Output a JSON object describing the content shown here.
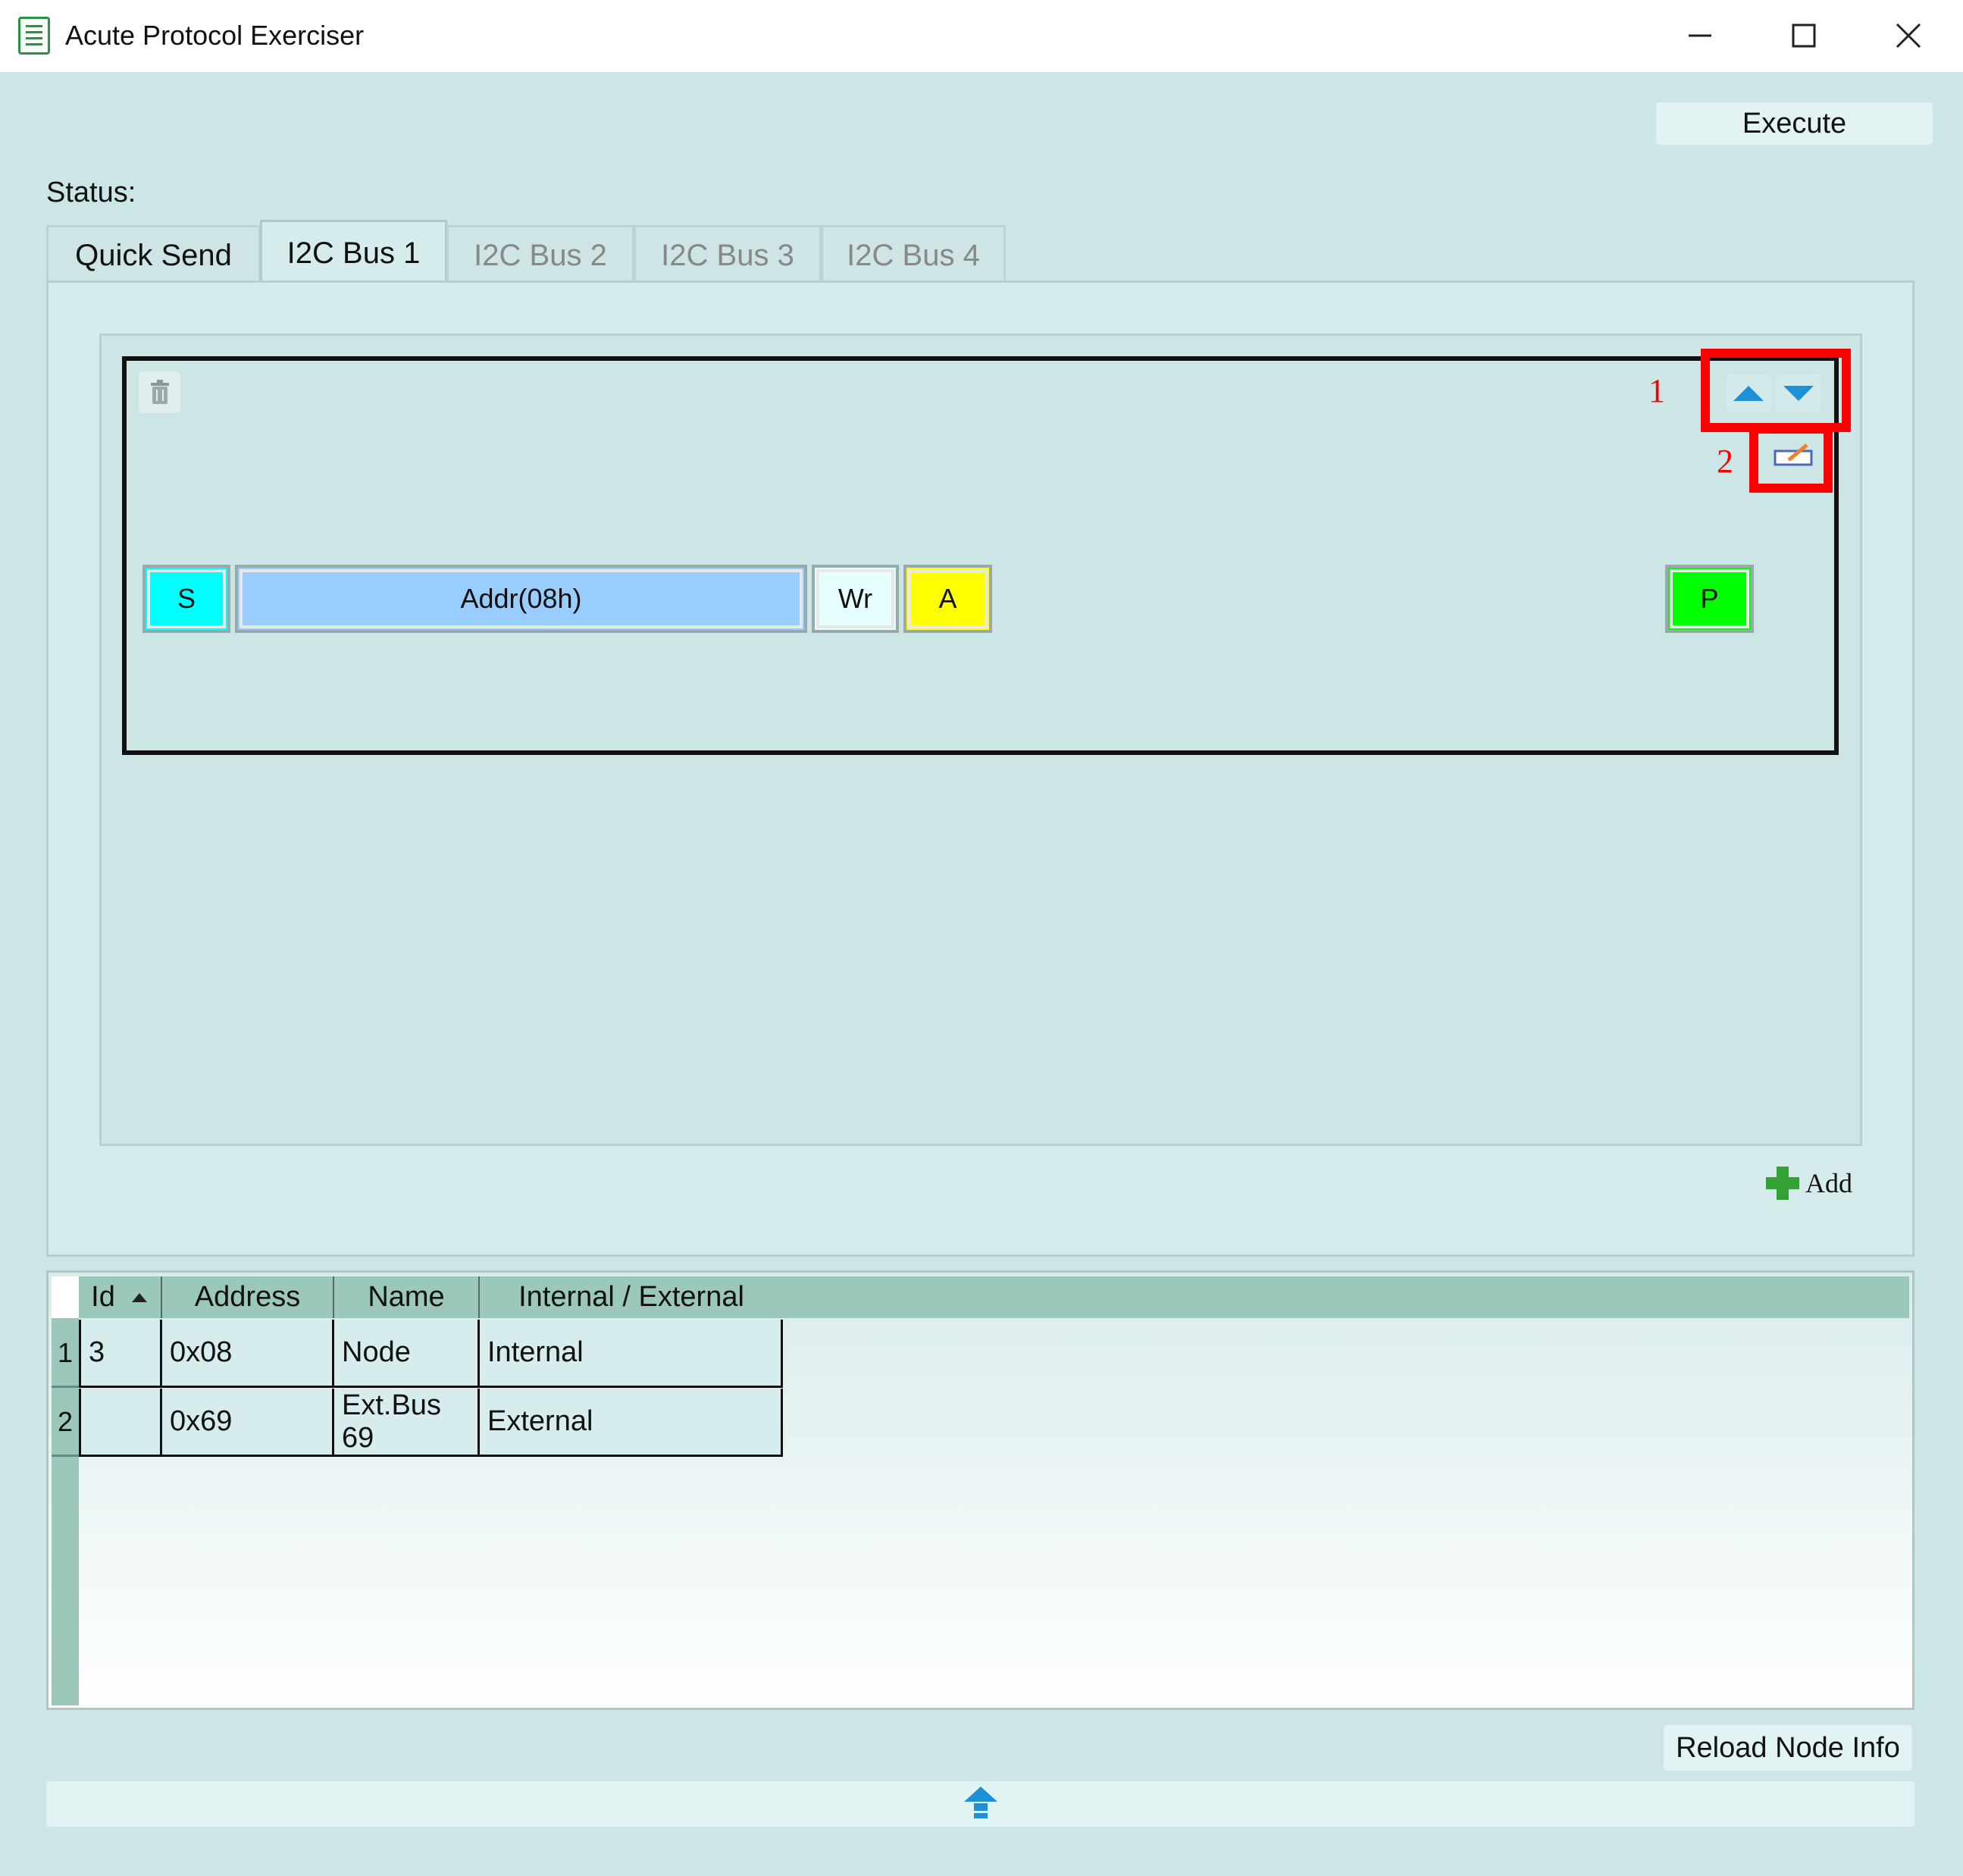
{
  "window": {
    "title": "Acute Protocol Exerciser",
    "controls": [
      "minimize",
      "maximize",
      "close"
    ]
  },
  "toolbar": {
    "execute_label": "Execute"
  },
  "status": {
    "label": "Status:"
  },
  "tabs": [
    {
      "label": "Quick Send",
      "active": false,
      "enabled": true
    },
    {
      "label": "I2C Bus 1",
      "active": true,
      "enabled": true
    },
    {
      "label": "I2C Bus 2",
      "active": false,
      "enabled": false
    },
    {
      "label": "I2C Bus 3",
      "active": false,
      "enabled": false
    },
    {
      "label": "I2C Bus 4",
      "active": false,
      "enabled": false
    }
  ],
  "sequence": {
    "segments": [
      {
        "label": "S",
        "color": "#00ffff"
      },
      {
        "label": "Addr(08h)",
        "color": "#99ccff"
      },
      {
        "label": "Wr",
        "color": "#e6ffff"
      },
      {
        "label": "A",
        "color": "#ffff00"
      },
      {
        "label": "P",
        "color": "#00ff00"
      }
    ],
    "annotations": {
      "move": "1",
      "edit": "2"
    },
    "icons": {
      "delete": "trash-icon",
      "up": "arrow-up-icon",
      "down": "arrow-down-icon",
      "edit": "edit-icon"
    }
  },
  "add": {
    "label": "Add",
    "icon": "plus-icon"
  },
  "node_table": {
    "columns": [
      "Id",
      "Address",
      "Name",
      "Internal / External"
    ],
    "sort_column": "Id",
    "rows": [
      {
        "num": "1",
        "id": "3",
        "address": "0x08",
        "name": "Node",
        "type": "Internal"
      },
      {
        "num": "2",
        "id": "",
        "address": "0x69",
        "name": "Ext.Bus 69",
        "type": "External"
      }
    ]
  },
  "reload": {
    "label": "Reload Node Info"
  },
  "colors": {
    "accent": "#1e90d6",
    "highlight": "#ff0000",
    "background": "#cce6e6"
  }
}
